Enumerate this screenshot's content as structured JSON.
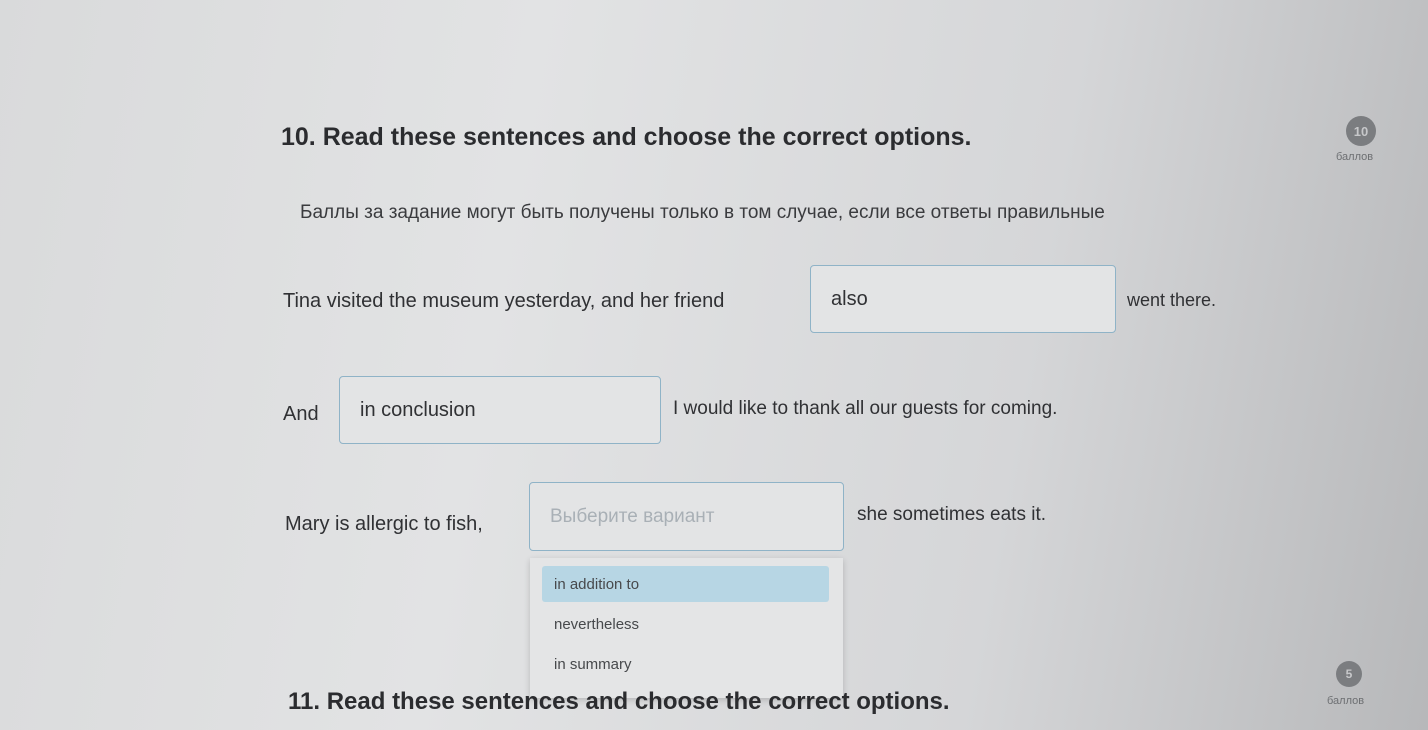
{
  "q10": {
    "title": "10. Read these sentences and choose the correct options.",
    "score_value": "10",
    "score_label": "баллов",
    "note": "Баллы за задание могут быть получены только в том случае, если все ответы правильные",
    "s1": {
      "before": "Tina visited the museum yesterday, and her friend",
      "answer": "also",
      "after": "went there."
    },
    "s2": {
      "before": "And",
      "answer": "in conclusion",
      "after": "I would like to thank all our guests for coming."
    },
    "s3": {
      "before": "Mary is allergic to fish,",
      "placeholder": "Выберите вариант",
      "after": "she sometimes eats it."
    },
    "dropdown_options": [
      "in addition to",
      "nevertheless",
      "in summary"
    ]
  },
  "q11": {
    "title": "11. Read these sentences and choose the correct options.",
    "score_value": "5",
    "score_label": "баллов"
  }
}
